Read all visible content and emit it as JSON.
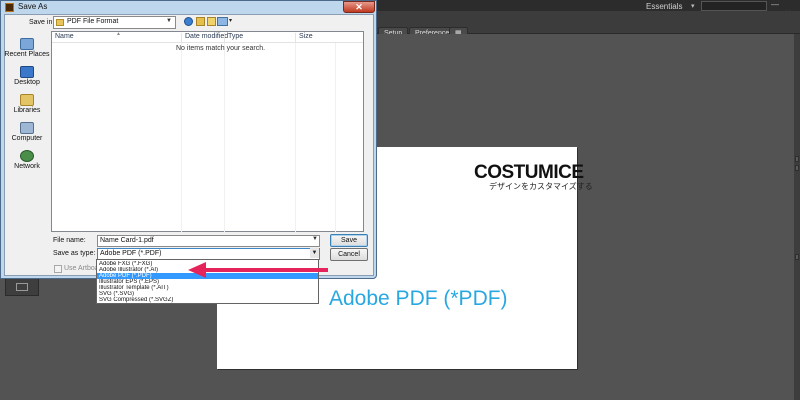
{
  "illustrator": {
    "toolbar": {
      "setup_label": "Setup",
      "preferences_label": "Preferences"
    },
    "workspace": {
      "name": "Essentials"
    }
  },
  "artboard": {
    "brand_name": "COSTUMICE",
    "brand_tagline": "デザインをカスタマイズする",
    "annotation_label": "Adobe PDF (*PDF)",
    "annotation_color": "#29a8e0"
  },
  "dialog": {
    "title": "Save As",
    "save_in": {
      "label": "Save in:",
      "value": "PDF File Format"
    },
    "places": [
      {
        "label": "Recent Places",
        "icon": "recent-places-icon"
      },
      {
        "label": "Desktop",
        "icon": "desktop-icon"
      },
      {
        "label": "Libraries",
        "icon": "libraries-icon"
      },
      {
        "label": "Computer",
        "icon": "computer-icon"
      },
      {
        "label": "Network",
        "icon": "network-icon"
      }
    ],
    "columns": [
      "Name",
      "Date modified",
      "Type",
      "Size"
    ],
    "empty_message": "No items match your search.",
    "file_name": {
      "label": "File name:",
      "value": "Name Card-1.pdf"
    },
    "save_as_type": {
      "label": "Save as type:",
      "value": "Adobe PDF (*.PDF)"
    },
    "buttons": {
      "save": "Save",
      "cancel": "Cancel"
    },
    "use_artboards": {
      "label": "Use Artboards",
      "checked": false,
      "enabled": false
    },
    "type_options": [
      "Adobe FXG (*.FXG)",
      "Adobe Illustrator (*.AI)",
      "Adobe PDF (*.PDF)",
      "Illustrator EPS (*.EPS)",
      "Illustrator Template (*.AIT)",
      "SVG (*.SVG)",
      "SVG Compressed (*.SVGZ)"
    ],
    "selected_option_index": 2
  },
  "colors": {
    "arrow": "#e5245c",
    "selection": "#3399ff",
    "workspace": "#535353"
  }
}
